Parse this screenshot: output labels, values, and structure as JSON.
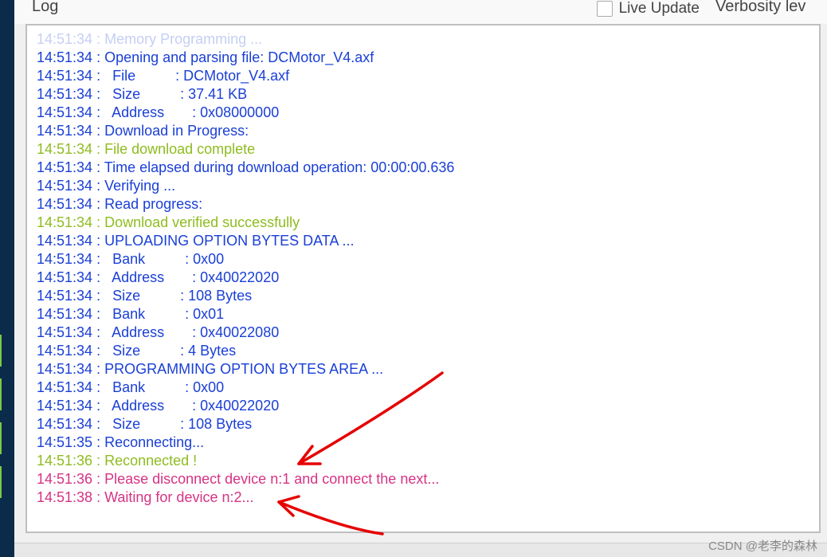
{
  "header": {
    "title": "Log",
    "live_update_label": "Live Update",
    "verbosity_label": "Verbosity lev"
  },
  "log_lines": [
    {
      "text": "14:51:34 : Memory Programming ...",
      "cls": "c-partial"
    },
    {
      "text": "14:51:34 : Opening and parsing file: DCMotor_V4.axf",
      "cls": "c-blue"
    },
    {
      "text": "14:51:34 :   File          : DCMotor_V4.axf",
      "cls": "c-blue"
    },
    {
      "text": "14:51:34 :   Size          : 37.41 KB",
      "cls": "c-blue"
    },
    {
      "text": "14:51:34 :   Address       : 0x08000000",
      "cls": "c-blue"
    },
    {
      "text": "14:51:34 : Download in Progress:",
      "cls": "c-blue"
    },
    {
      "text": "14:51:34 : File download complete",
      "cls": "c-green"
    },
    {
      "text": "14:51:34 : Time elapsed during download operation: 00:00:00.636",
      "cls": "c-blue"
    },
    {
      "text": "14:51:34 : Verifying ...",
      "cls": "c-blue"
    },
    {
      "text": "14:51:34 : Read progress:",
      "cls": "c-blue"
    },
    {
      "text": "14:51:34 : Download verified successfully",
      "cls": "c-green"
    },
    {
      "text": "14:51:34 : UPLOADING OPTION BYTES DATA ...",
      "cls": "c-blue"
    },
    {
      "text": "14:51:34 :   Bank          : 0x00",
      "cls": "c-blue"
    },
    {
      "text": "14:51:34 :   Address       : 0x40022020",
      "cls": "c-blue"
    },
    {
      "text": "14:51:34 :   Size          : 108 Bytes",
      "cls": "c-blue"
    },
    {
      "text": "14:51:34 :   Bank          : 0x01",
      "cls": "c-blue"
    },
    {
      "text": "14:51:34 :   Address       : 0x40022080",
      "cls": "c-blue"
    },
    {
      "text": "14:51:34 :   Size          : 4 Bytes",
      "cls": "c-blue"
    },
    {
      "text": "14:51:34 : PROGRAMMING OPTION BYTES AREA ...",
      "cls": "c-blue"
    },
    {
      "text": "14:51:34 :   Bank          : 0x00",
      "cls": "c-blue"
    },
    {
      "text": "14:51:34 :   Address       : 0x40022020",
      "cls": "c-blue"
    },
    {
      "text": "14:51:34 :   Size          : 108 Bytes",
      "cls": "c-blue"
    },
    {
      "text": "14:51:35 : Reconnecting...",
      "cls": "c-blue"
    },
    {
      "text": "14:51:36 : Reconnected !",
      "cls": "c-green"
    },
    {
      "text": "14:51:36 : Please disconnect device n:1 and connect the next...",
      "cls": "c-magenta"
    },
    {
      "text": "14:51:38 : Waiting for device n:2...",
      "cls": "c-magenta"
    }
  ],
  "watermark": "CSDN @老李的森林"
}
